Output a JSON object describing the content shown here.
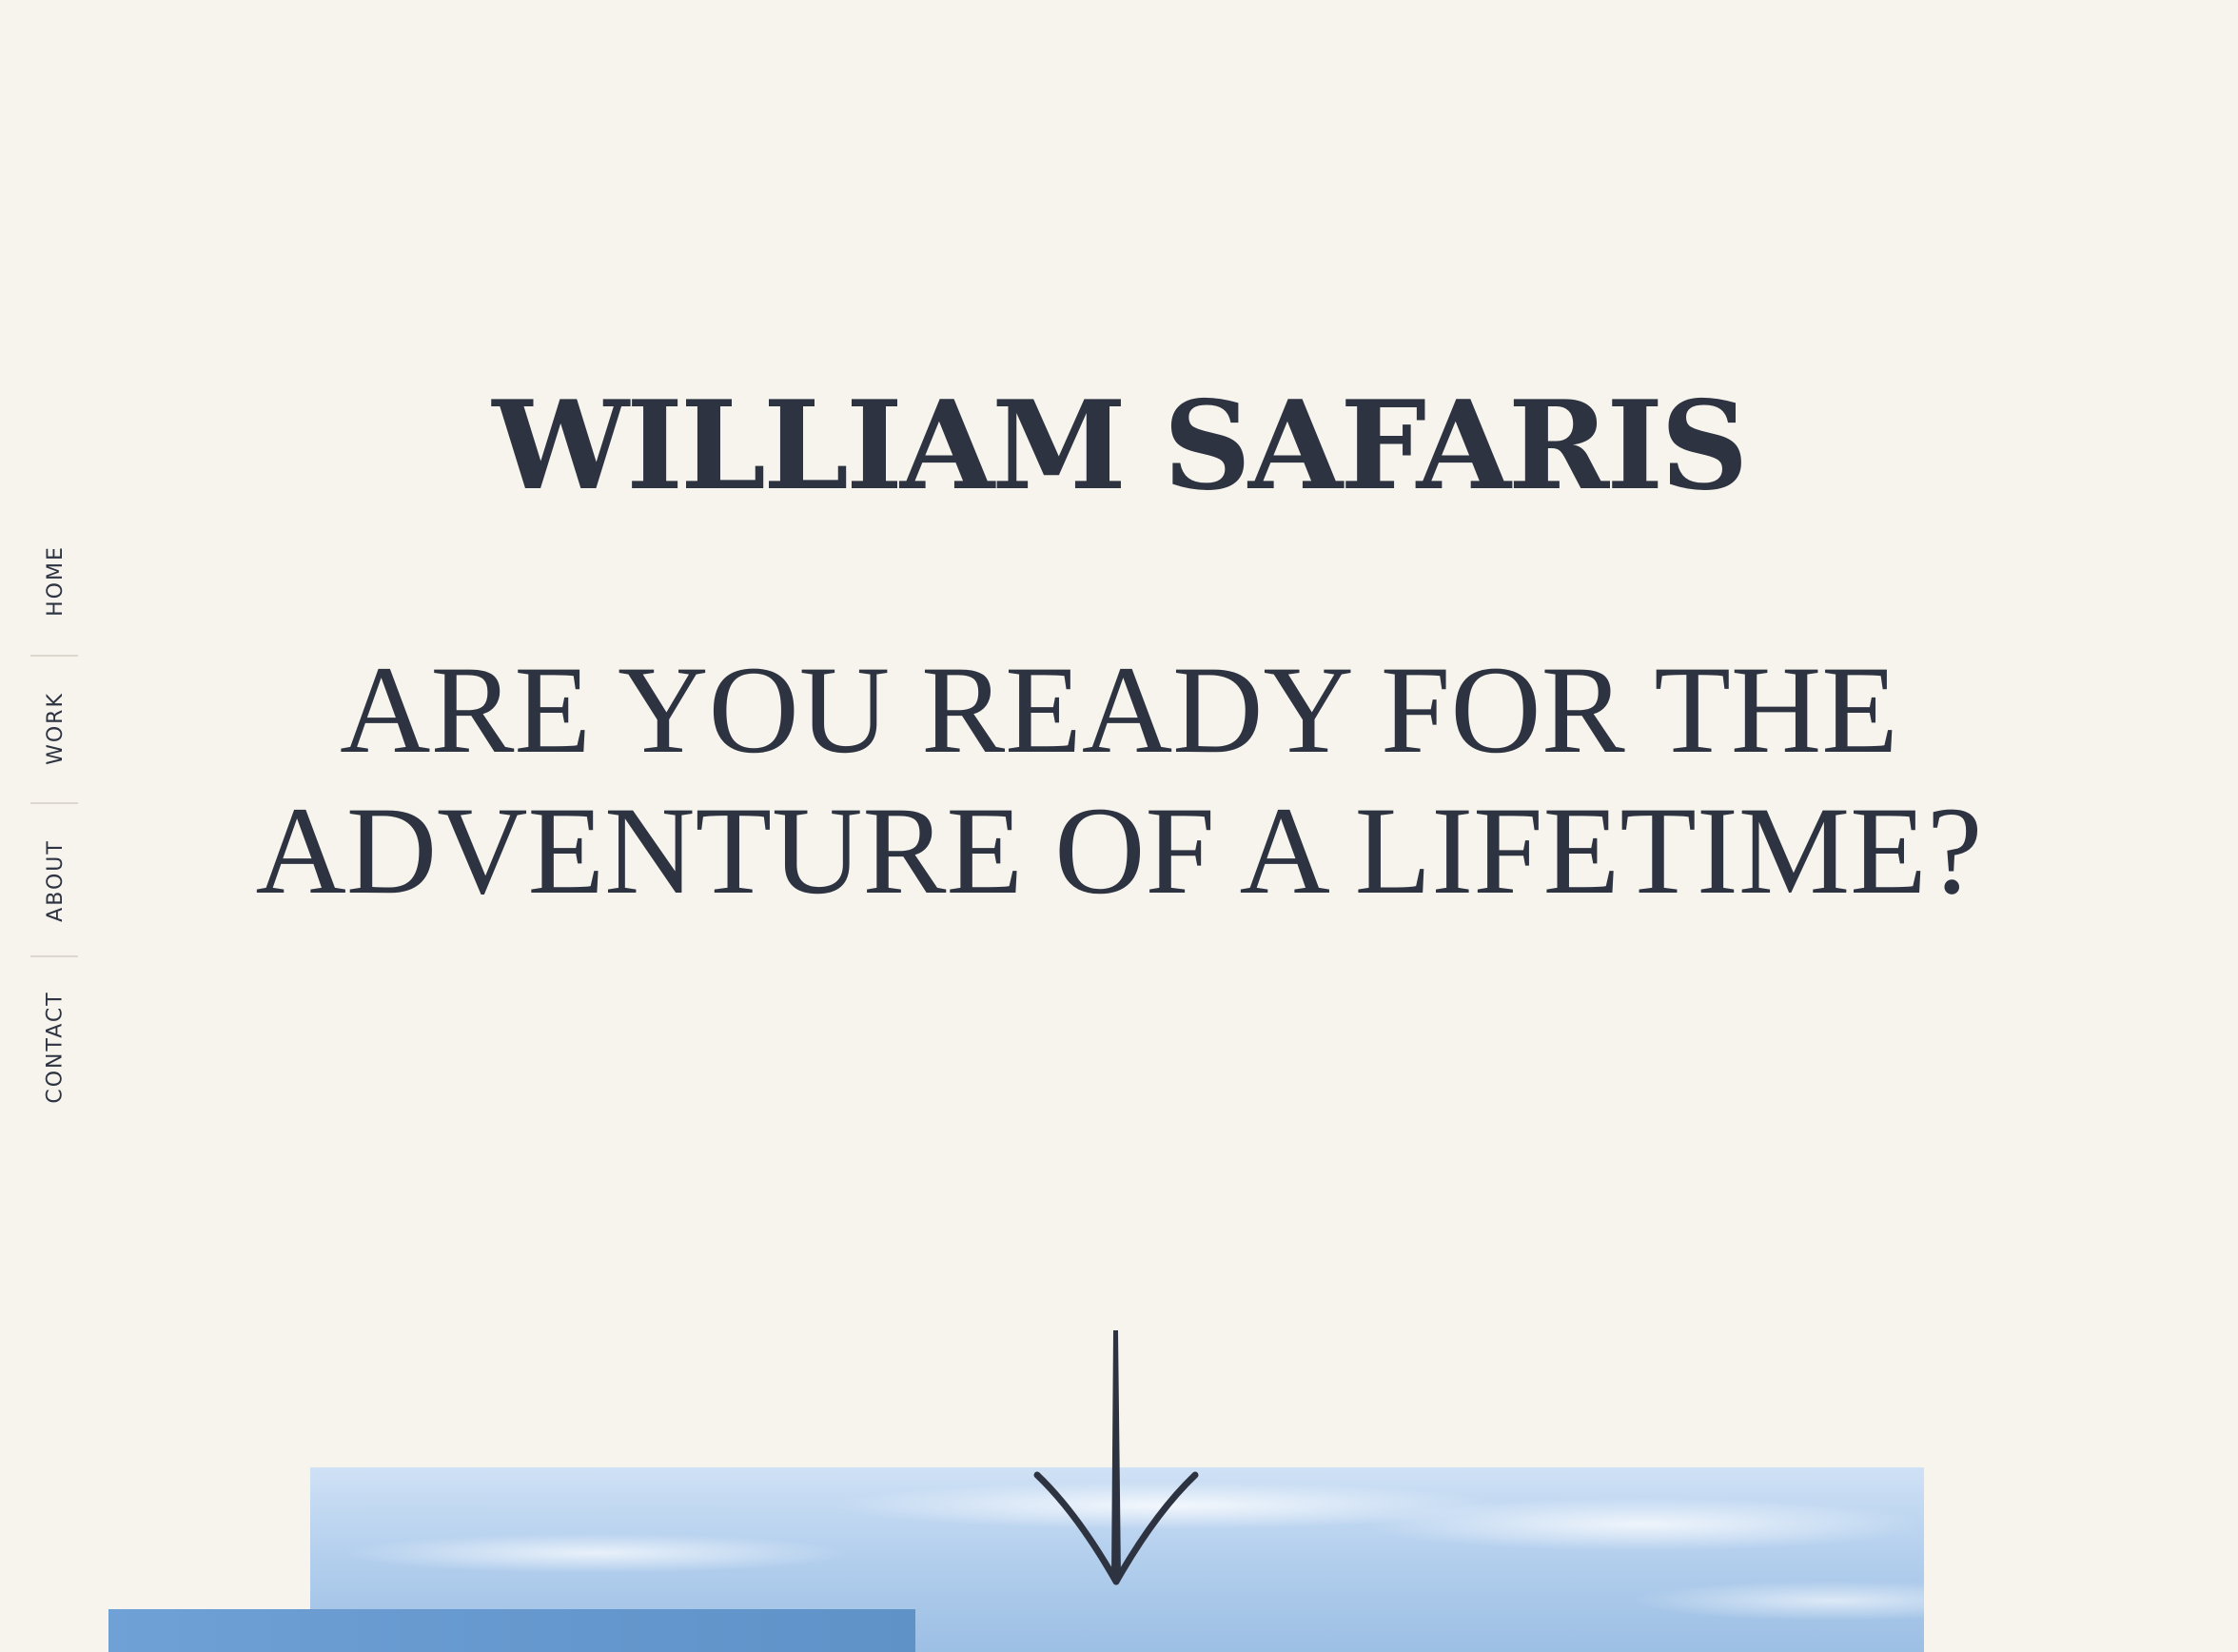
{
  "nav": {
    "items": [
      {
        "label": "HOME"
      },
      {
        "label": "WORK"
      },
      {
        "label": "ABOUT"
      },
      {
        "label": "CONTACT"
      }
    ]
  },
  "hero": {
    "title": "WILLIAM SAFARIS",
    "tagline_line1": "ARE YOU READY FOR THE",
    "tagline_line2": "ADVENTURE OF A LIFETIME?",
    "scroll_icon": "arrow-down-icon"
  },
  "colors": {
    "background": "#f7f4ee",
    "text": "#2d3340",
    "sky": "#9cbfe4"
  }
}
